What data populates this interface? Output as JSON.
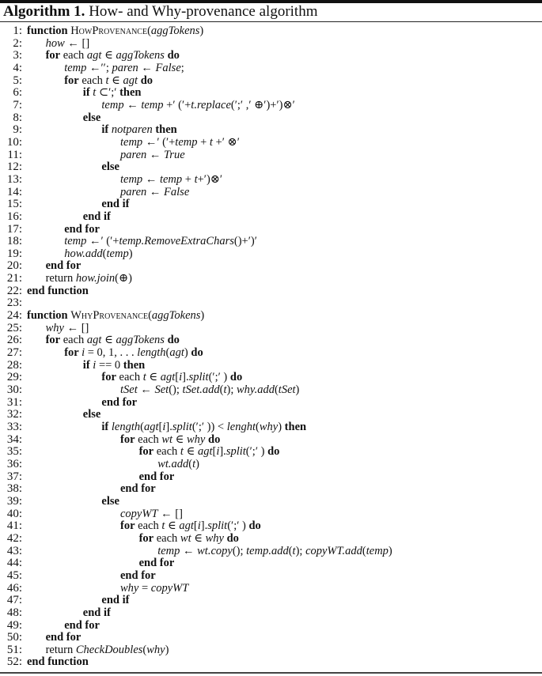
{
  "caption": {
    "label": "Algorithm 1.",
    "text": "How- and Why-provenance algorithm"
  },
  "lines": [
    {
      "n": "1:",
      "indent": 0,
      "parts": [
        [
          "kw",
          "function "
        ],
        [
          "sc",
          "HowProvenance"
        ],
        [
          "n",
          "("
        ],
        [
          "it",
          "aggTokens"
        ],
        [
          "n",
          ")"
        ]
      ]
    },
    {
      "n": "2:",
      "indent": 1,
      "parts": [
        [
          "it",
          "how"
        ],
        [
          "n",
          " ← []"
        ]
      ]
    },
    {
      "n": "3:",
      "indent": 1,
      "parts": [
        [
          "kw",
          "for"
        ],
        [
          "n",
          " each "
        ],
        [
          "it",
          "agt"
        ],
        [
          "n",
          " ∈ "
        ],
        [
          "it",
          "aggTokens"
        ],
        [
          "kw",
          " do"
        ]
      ]
    },
    {
      "n": "4:",
      "indent": 2,
      "parts": [
        [
          "it",
          "temp"
        ],
        [
          "n",
          " ←′′; "
        ],
        [
          "it",
          "paren"
        ],
        [
          "n",
          " ← "
        ],
        [
          "it",
          "False"
        ],
        [
          "n",
          ";"
        ]
      ]
    },
    {
      "n": "5:",
      "indent": 2,
      "parts": [
        [
          "kw",
          "for"
        ],
        [
          "n",
          " each "
        ],
        [
          "it",
          "t"
        ],
        [
          "n",
          " ∈ "
        ],
        [
          "it",
          "agt"
        ],
        [
          "kw",
          " do"
        ]
      ]
    },
    {
      "n": "6:",
      "indent": 3,
      "parts": [
        [
          "kw",
          "if "
        ],
        [
          "it",
          "t"
        ],
        [
          "n",
          " ⊂′;′ "
        ],
        [
          "kw",
          "then"
        ]
      ]
    },
    {
      "n": "7:",
      "indent": 4,
      "parts": [
        [
          "it",
          "temp"
        ],
        [
          "n",
          " ← "
        ],
        [
          "it",
          "temp"
        ],
        [
          "n",
          " +′ (′+"
        ],
        [
          "it",
          "t.replace"
        ],
        [
          "n",
          "(′;′ ,′ ⊕′)+′)⊗′"
        ]
      ]
    },
    {
      "n": "8:",
      "indent": 3,
      "parts": [
        [
          "kw",
          "else"
        ]
      ]
    },
    {
      "n": "9:",
      "indent": 4,
      "parts": [
        [
          "kw",
          "if "
        ],
        [
          "it",
          "notparen"
        ],
        [
          "kw",
          " then"
        ]
      ]
    },
    {
      "n": "10:",
      "indent": 5,
      "parts": [
        [
          "it",
          "temp"
        ],
        [
          "n",
          " ←′ (′+"
        ],
        [
          "it",
          "temp"
        ],
        [
          "n",
          " + "
        ],
        [
          "it",
          "t"
        ],
        [
          "n",
          " +′ ⊗′"
        ]
      ]
    },
    {
      "n": "11:",
      "indent": 5,
      "parts": [
        [
          "it",
          "paren"
        ],
        [
          "n",
          " ← "
        ],
        [
          "it",
          "True"
        ]
      ]
    },
    {
      "n": "12:",
      "indent": 4,
      "parts": [
        [
          "kw",
          "else"
        ]
      ]
    },
    {
      "n": "13:",
      "indent": 5,
      "parts": [
        [
          "it",
          "temp"
        ],
        [
          "n",
          " ← "
        ],
        [
          "it",
          "temp"
        ],
        [
          "n",
          " + "
        ],
        [
          "it",
          "t"
        ],
        [
          "n",
          "+′)⊗′"
        ]
      ]
    },
    {
      "n": "14:",
      "indent": 5,
      "parts": [
        [
          "it",
          "paren"
        ],
        [
          "n",
          " ← "
        ],
        [
          "it",
          "False"
        ]
      ]
    },
    {
      "n": "15:",
      "indent": 4,
      "parts": [
        [
          "kw",
          "end if"
        ]
      ]
    },
    {
      "n": "16:",
      "indent": 3,
      "parts": [
        [
          "kw",
          "end if"
        ]
      ]
    },
    {
      "n": "17:",
      "indent": 2,
      "parts": [
        [
          "kw",
          "end for"
        ]
      ]
    },
    {
      "n": "18:",
      "indent": 2,
      "parts": [
        [
          "it",
          "temp"
        ],
        [
          "n",
          " ←′ (′+"
        ],
        [
          "it",
          "temp.RemoveExtraChars"
        ],
        [
          "n",
          "()+′)′"
        ]
      ]
    },
    {
      "n": "19:",
      "indent": 2,
      "parts": [
        [
          "it",
          "how.add"
        ],
        [
          "n",
          "("
        ],
        [
          "it",
          "temp"
        ],
        [
          "n",
          ")"
        ]
      ]
    },
    {
      "n": "20:",
      "indent": 1,
      "parts": [
        [
          "kw",
          "end for"
        ]
      ]
    },
    {
      "n": "21:",
      "indent": 1,
      "parts": [
        [
          "n",
          "return "
        ],
        [
          "it",
          "how.join"
        ],
        [
          "n",
          "(⊕)"
        ]
      ]
    },
    {
      "n": "22:",
      "indent": 0,
      "parts": [
        [
          "kw",
          "end function"
        ]
      ]
    },
    {
      "n": "23:",
      "indent": 0,
      "parts": []
    },
    {
      "n": "24:",
      "indent": 0,
      "parts": [
        [
          "kw",
          "function "
        ],
        [
          "sc",
          "WhyProvenance"
        ],
        [
          "n",
          "("
        ],
        [
          "it",
          "aggTokens"
        ],
        [
          "n",
          ")"
        ]
      ]
    },
    {
      "n": "25:",
      "indent": 1,
      "parts": [
        [
          "it",
          "why"
        ],
        [
          "n",
          " ← []"
        ]
      ]
    },
    {
      "n": "26:",
      "indent": 1,
      "parts": [
        [
          "kw",
          "for"
        ],
        [
          "n",
          " each "
        ],
        [
          "it",
          "agt"
        ],
        [
          "n",
          " ∈ "
        ],
        [
          "it",
          "aggTokens"
        ],
        [
          "kw",
          " do"
        ]
      ]
    },
    {
      "n": "27:",
      "indent": 2,
      "parts": [
        [
          "kw",
          "for "
        ],
        [
          "it",
          "i"
        ],
        [
          "n",
          " = 0, 1, . . . "
        ],
        [
          "it",
          "length"
        ],
        [
          "n",
          "("
        ],
        [
          "it",
          "agt"
        ],
        [
          "n",
          ") "
        ],
        [
          "kw",
          "do"
        ]
      ]
    },
    {
      "n": "28:",
      "indent": 3,
      "parts": [
        [
          "kw",
          "if "
        ],
        [
          "it",
          "i"
        ],
        [
          "n",
          " == 0 "
        ],
        [
          "kw",
          "then"
        ]
      ]
    },
    {
      "n": "29:",
      "indent": 4,
      "parts": [
        [
          "kw",
          "for"
        ],
        [
          "n",
          " each "
        ],
        [
          "it",
          "t"
        ],
        [
          "n",
          " ∈ "
        ],
        [
          "it",
          "agt"
        ],
        [
          "n",
          "["
        ],
        [
          "it",
          "i"
        ],
        [
          "n",
          "]."
        ],
        [
          "it",
          "split"
        ],
        [
          "n",
          "(′;′ ) "
        ],
        [
          "kw",
          "do"
        ]
      ]
    },
    {
      "n": "30:",
      "indent": 5,
      "parts": [
        [
          "it",
          "tSet"
        ],
        [
          "n",
          " ← "
        ],
        [
          "it",
          "Set"
        ],
        [
          "n",
          "(); "
        ],
        [
          "it",
          "tSet.add"
        ],
        [
          "n",
          "("
        ],
        [
          "it",
          "t"
        ],
        [
          "n",
          "); "
        ],
        [
          "it",
          "why.add"
        ],
        [
          "n",
          "("
        ],
        [
          "it",
          "tSet"
        ],
        [
          "n",
          ")"
        ]
      ]
    },
    {
      "n": "31:",
      "indent": 4,
      "parts": [
        [
          "kw",
          "end for"
        ]
      ]
    },
    {
      "n": "32:",
      "indent": 3,
      "parts": [
        [
          "kw",
          "else"
        ]
      ]
    },
    {
      "n": "33:",
      "indent": 4,
      "parts": [
        [
          "kw",
          "if "
        ],
        [
          "it",
          "length"
        ],
        [
          "n",
          "("
        ],
        [
          "it",
          "agt"
        ],
        [
          "n",
          "["
        ],
        [
          "it",
          "i"
        ],
        [
          "n",
          "]."
        ],
        [
          "it",
          "split"
        ],
        [
          "n",
          "(′;′ )) < "
        ],
        [
          "it",
          "lenght"
        ],
        [
          "n",
          "("
        ],
        [
          "it",
          "why"
        ],
        [
          "n",
          ") "
        ],
        [
          "kw",
          "then"
        ]
      ]
    },
    {
      "n": "34:",
      "indent": 5,
      "parts": [
        [
          "kw",
          "for"
        ],
        [
          "n",
          " each "
        ],
        [
          "it",
          "wt"
        ],
        [
          "n",
          " ∈ "
        ],
        [
          "it",
          "why"
        ],
        [
          "kw",
          " do"
        ]
      ]
    },
    {
      "n": "35:",
      "indent": 6,
      "parts": [
        [
          "kw",
          "for"
        ],
        [
          "n",
          " each "
        ],
        [
          "it",
          "t"
        ],
        [
          "n",
          " ∈ "
        ],
        [
          "it",
          "agt"
        ],
        [
          "n",
          "["
        ],
        [
          "it",
          "i"
        ],
        [
          "n",
          "]."
        ],
        [
          "it",
          "split"
        ],
        [
          "n",
          "(′;′ ) "
        ],
        [
          "kw",
          "do"
        ]
      ]
    },
    {
      "n": "36:",
      "indent": 7,
      "parts": [
        [
          "it",
          "wt.add"
        ],
        [
          "n",
          "("
        ],
        [
          "it",
          "t"
        ],
        [
          "n",
          ")"
        ]
      ]
    },
    {
      "n": "37:",
      "indent": 6,
      "parts": [
        [
          "kw",
          "end for"
        ]
      ]
    },
    {
      "n": "38:",
      "indent": 5,
      "parts": [
        [
          "kw",
          "end for"
        ]
      ]
    },
    {
      "n": "39:",
      "indent": 4,
      "parts": [
        [
          "kw",
          "else"
        ]
      ]
    },
    {
      "n": "40:",
      "indent": 5,
      "parts": [
        [
          "it",
          "copyWT"
        ],
        [
          "n",
          " ← []"
        ]
      ]
    },
    {
      "n": "41:",
      "indent": 5,
      "parts": [
        [
          "kw",
          "for"
        ],
        [
          "n",
          " each "
        ],
        [
          "it",
          "t"
        ],
        [
          "n",
          " ∈ "
        ],
        [
          "it",
          "agt"
        ],
        [
          "n",
          "["
        ],
        [
          "it",
          "i"
        ],
        [
          "n",
          "]."
        ],
        [
          "it",
          "split"
        ],
        [
          "n",
          "(′;′ ) "
        ],
        [
          "kw",
          "do"
        ]
      ]
    },
    {
      "n": "42:",
      "indent": 6,
      "parts": [
        [
          "kw",
          "for"
        ],
        [
          "n",
          " each "
        ],
        [
          "it",
          "wt"
        ],
        [
          "n",
          " ∈ "
        ],
        [
          "it",
          "why"
        ],
        [
          "kw",
          " do"
        ]
      ]
    },
    {
      "n": "43:",
      "indent": 7,
      "parts": [
        [
          "it",
          "temp"
        ],
        [
          "n",
          " ← "
        ],
        [
          "it",
          "wt.copy"
        ],
        [
          "n",
          "(); "
        ],
        [
          "it",
          "temp.add"
        ],
        [
          "n",
          "("
        ],
        [
          "it",
          "t"
        ],
        [
          "n",
          "); "
        ],
        [
          "it",
          "copyWT.add"
        ],
        [
          "n",
          "("
        ],
        [
          "it",
          "temp"
        ],
        [
          "n",
          ")"
        ]
      ]
    },
    {
      "n": "44:",
      "indent": 6,
      "parts": [
        [
          "kw",
          "end for"
        ]
      ]
    },
    {
      "n": "45:",
      "indent": 5,
      "parts": [
        [
          "kw",
          "end for"
        ]
      ]
    },
    {
      "n": "46:",
      "indent": 5,
      "parts": [
        [
          "it",
          "why"
        ],
        [
          "n",
          " = "
        ],
        [
          "it",
          "copyWT"
        ]
      ]
    },
    {
      "n": "47:",
      "indent": 4,
      "parts": [
        [
          "kw",
          "end if"
        ]
      ]
    },
    {
      "n": "48:",
      "indent": 3,
      "parts": [
        [
          "kw",
          "end if"
        ]
      ]
    },
    {
      "n": "49:",
      "indent": 2,
      "parts": [
        [
          "kw",
          "end for"
        ]
      ]
    },
    {
      "n": "50:",
      "indent": 1,
      "parts": [
        [
          "kw",
          "end for"
        ]
      ]
    },
    {
      "n": "51:",
      "indent": 1,
      "parts": [
        [
          "n",
          "return "
        ],
        [
          "it",
          "CheckDoubles"
        ],
        [
          "n",
          "("
        ],
        [
          "it",
          "why"
        ],
        [
          "n",
          ")"
        ]
      ]
    },
    {
      "n": "52:",
      "indent": 0,
      "parts": [
        [
          "kw",
          "end function"
        ]
      ]
    }
  ]
}
